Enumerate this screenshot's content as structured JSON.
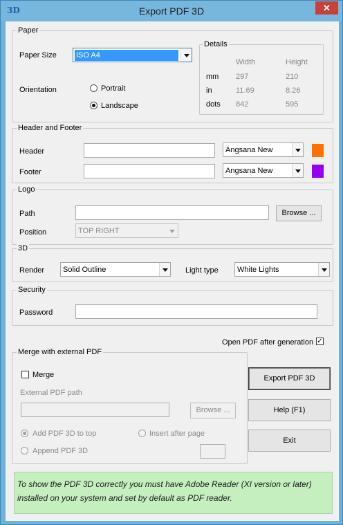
{
  "window": {
    "title": "Export PDF 3D",
    "app_icon": "3D",
    "close_icon": "close-icon"
  },
  "paper": {
    "group_label": "Paper",
    "size_label": "Paper Size",
    "size_value": "ISO A4",
    "orientation_label": "Orientation",
    "portrait_label": "Portrait",
    "landscape_label": "Landscape",
    "orientation_selected": "Landscape",
    "details": {
      "group_label": "Details",
      "col_width": "Width",
      "col_height": "Height",
      "rows": [
        {
          "unit": "mm",
          "width": "297",
          "height": "210"
        },
        {
          "unit": "in",
          "width": "11.69",
          "height": "8.26"
        },
        {
          "unit": "dots",
          "width": "842",
          "height": "595"
        }
      ]
    }
  },
  "header_footer": {
    "group_label": "Header and Footer",
    "header_label": "Header",
    "header_value": "",
    "header_font": "Angsana New",
    "header_color": "#ff7000",
    "footer_label": "Footer",
    "footer_value": "",
    "footer_font": "Angsana New",
    "footer_color": "#9400f0"
  },
  "logo": {
    "group_label": "Logo",
    "path_label": "Path",
    "path_value": "",
    "browse_label": "Browse ...",
    "position_label": "Position",
    "position_value": "TOP RIGHT"
  },
  "three_d": {
    "group_label": "3D",
    "render_label": "Render",
    "render_value": "Solid Outline",
    "light_label": "Light type",
    "light_value": "White Lights"
  },
  "security": {
    "group_label": "Security",
    "password_label": "Password",
    "password_value": ""
  },
  "open_after": {
    "label": "Open PDF after generation",
    "checked": true
  },
  "merge": {
    "group_label": "Merge with external PDF",
    "merge_label": "Merge",
    "merge_checked": false,
    "ext_path_label": "External PDF path",
    "ext_path_value": "",
    "browse_label": "Browse ...",
    "add_top_label": "Add PDF 3D to top",
    "insert_after_label": "Insert after page",
    "append_label": "Append PDF 3D",
    "insert_page_value": ""
  },
  "actions": {
    "export_label": "Export PDF 3D",
    "help_label": "Help (F1)",
    "exit_label": "Exit"
  },
  "info_text": "To show the PDF 3D correctly you must have Adobe Reader (XI version or later) installed on your system and set by default as PDF reader."
}
